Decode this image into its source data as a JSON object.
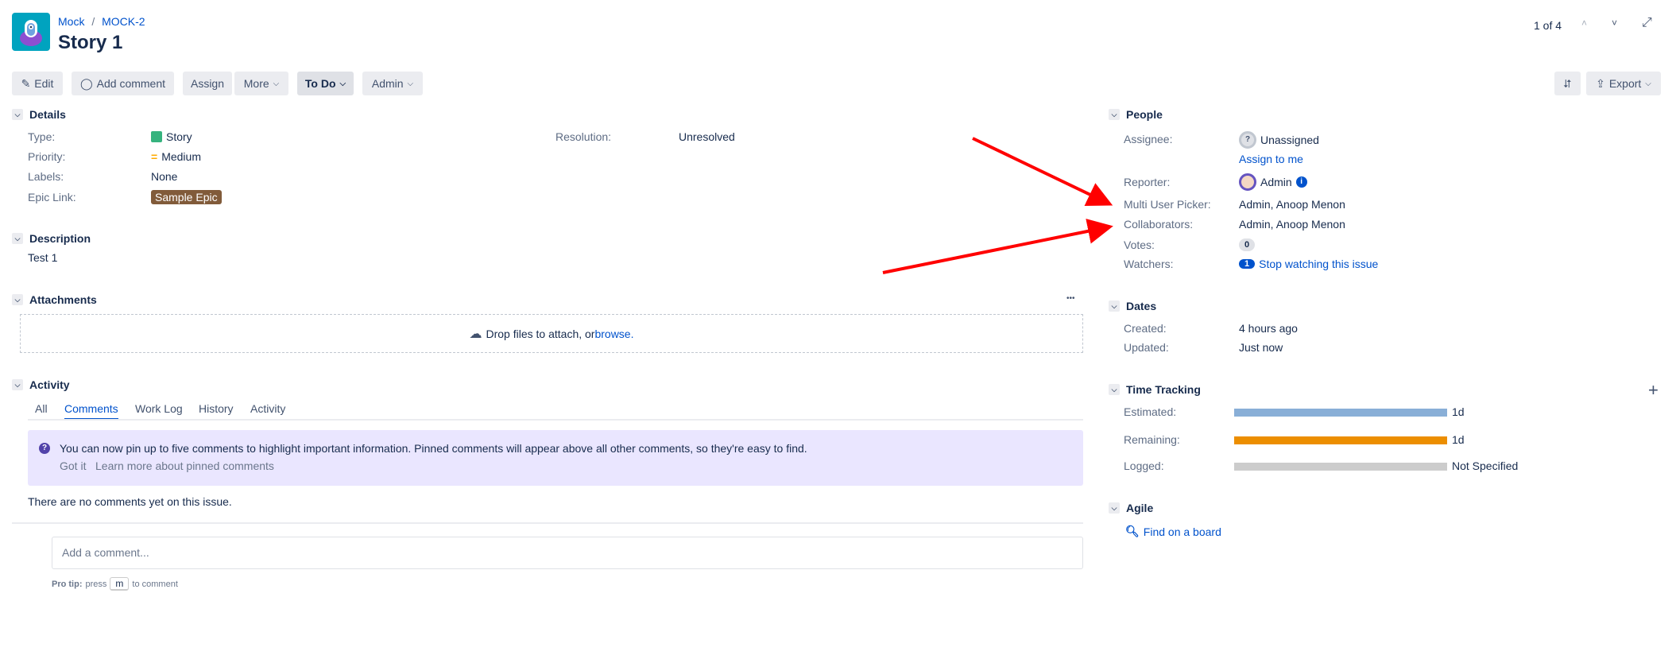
{
  "header": {
    "breadcrumb": [
      "Mock",
      "MOCK-2"
    ],
    "title": "Story 1",
    "pager": "1 of 4"
  },
  "toolbar": {
    "edit": "Edit",
    "add_comment": "Add comment",
    "assign": "Assign",
    "more": "More",
    "status": "To Do",
    "admin": "Admin",
    "export": "Export"
  },
  "details": {
    "title": "Details",
    "rows": [
      {
        "label": "Type:",
        "value": "Story"
      },
      {
        "label": "Priority:",
        "value": "Medium"
      },
      {
        "label": "Labels:",
        "value": "None"
      },
      {
        "label": "Epic Link:",
        "value": "Sample Epic"
      }
    ],
    "resolution_label": "Resolution:",
    "resolution_value": "Unresolved"
  },
  "description": {
    "title": "Description",
    "text": "Test 1"
  },
  "attachments": {
    "title": "Attachments",
    "drop_text": "Drop files to attach, or ",
    "browse": "browse.",
    "menu": "•••"
  },
  "activity": {
    "title": "Activity",
    "tabs": [
      "All",
      "Comments",
      "Work Log",
      "History",
      "Activity"
    ],
    "active_tab": "Comments",
    "info": "You can now pin up to five comments to highlight important information. Pinned comments will appear above all other comments, so they're easy to find.",
    "got_it": "Got it",
    "learn_more": "Learn more about pinned comments",
    "empty": "There are no comments yet on this issue.",
    "comment_placeholder": "Add a comment...",
    "pro_tip_label": "Pro tip:",
    "pro_tip_press": "press",
    "pro_tip_key": "m",
    "pro_tip_rest": "to comment"
  },
  "people": {
    "title": "People",
    "assignee_label": "Assignee:",
    "assignee": "Unassigned",
    "assign_to_me": "Assign to me",
    "reporter_label": "Reporter:",
    "reporter": "Admin",
    "multi_label": "Multi User Picker:",
    "multi": "Admin, Anoop Menon",
    "collab_label": "Collaborators:",
    "collab": "Admin, Anoop Menon",
    "votes_label": "Votes:",
    "votes": "0",
    "watchers_label": "Watchers:",
    "watchers": "1",
    "stop_watching": "Stop watching this issue"
  },
  "dates": {
    "title": "Dates",
    "created_label": "Created:",
    "created": "4 hours ago",
    "updated_label": "Updated:",
    "updated": "Just now"
  },
  "time_tracking": {
    "title": "Time Tracking",
    "estimated_label": "Estimated:",
    "estimated": "1d",
    "remaining_label": "Remaining:",
    "remaining": "1d",
    "logged_label": "Logged:",
    "logged": "Not Specified",
    "colors": {
      "estimated": "#89afd7",
      "remaining": "#ec8e00",
      "logged": "#cccccc"
    }
  },
  "agile": {
    "title": "Agile",
    "find": "Find on a board"
  }
}
